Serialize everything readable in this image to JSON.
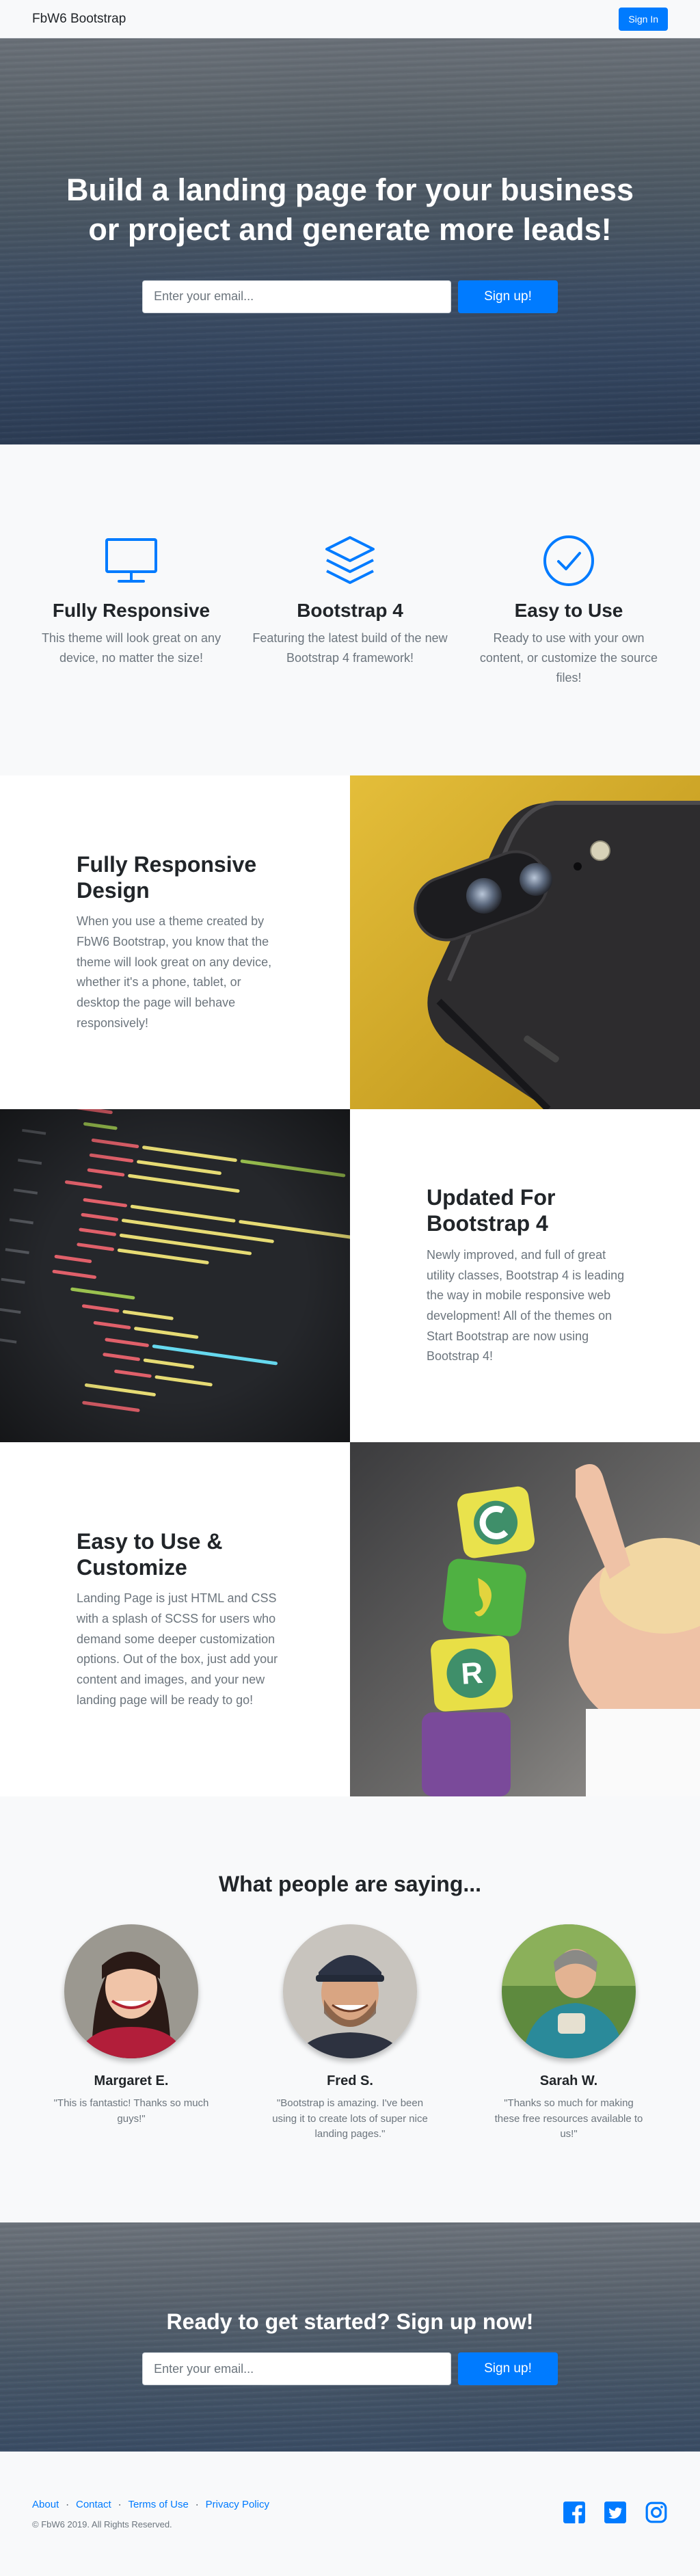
{
  "navbar": {
    "brand": "FbW6 Bootstrap",
    "sign_in": "Sign In"
  },
  "masthead": {
    "heading": "Build a landing page for your business or project and generate more leads!",
    "email_placeholder": "Enter your email...",
    "signup_label": "Sign up!"
  },
  "features": [
    {
      "icon": "monitor-icon",
      "title": "Fully Responsive",
      "text": "This theme will look great on any device, no matter the size!"
    },
    {
      "icon": "layers-icon",
      "title": "Bootstrap 4",
      "text": "Featuring the latest build of the new Bootstrap 4 framework!"
    },
    {
      "icon": "check-circle-icon",
      "title": "Easy to Use",
      "text": "Ready to use with your own content, or customize the source files!"
    }
  ],
  "showcase": [
    {
      "title": "Fully Responsive Design",
      "text": "When you use a theme created by FbW6 Bootstrap, you know that the theme will look great on any device, whether it's a phone, tablet, or desktop the page will behave responsively!"
    },
    {
      "title": "Updated For Bootstrap 4",
      "text": "Newly improved, and full of great utility classes, Bootstrap 4 is leading the way in mobile responsive web development! All of the themes on Start Bootstrap are now using Bootstrap 4!"
    },
    {
      "title": "Easy to Use & Customize",
      "text": "Landing Page is just HTML and CSS with a splash of SCSS for users who demand some deeper customization options. Out of the box, just add your content and images, and your new landing page will be ready to go!"
    }
  ],
  "testimonials": {
    "heading": "What people are saying...",
    "items": [
      {
        "name": "Margaret E.",
        "quote": "\"This is fantastic! Thanks so much guys!\""
      },
      {
        "name": "Fred S.",
        "quote": "\"Bootstrap is amazing. I've been using it to create lots of super nice landing pages.\""
      },
      {
        "name": "Sarah W.",
        "quote": "\"Thanks so much for making these free resources available to us!\""
      }
    ]
  },
  "cta": {
    "heading": "Ready to get started? Sign up now!",
    "email_placeholder": "Enter your email...",
    "signup_label": "Sign up!"
  },
  "footer": {
    "links": [
      "About",
      "Contact",
      "Terms of Use",
      "Privacy Policy"
    ],
    "copyright": "© FbW6 2019. All Rights Reserved.",
    "socials": [
      "facebook-icon",
      "twitter-icon",
      "instagram-icon"
    ]
  },
  "colors": {
    "primary": "#007bff",
    "light": "#f8f9fa",
    "muted": "#6c757d"
  }
}
